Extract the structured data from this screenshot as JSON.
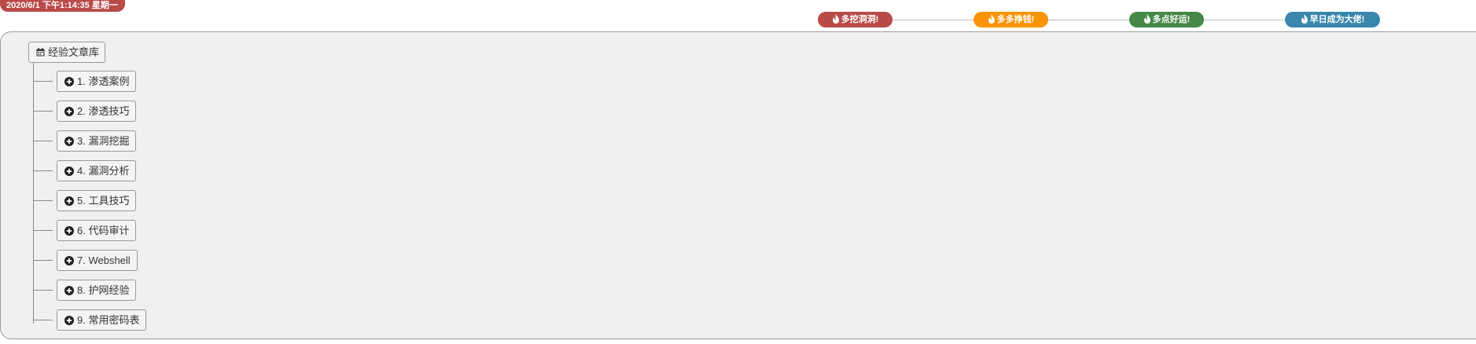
{
  "header": {
    "datetime": "2020/6/1 下午1:14:35 星期一",
    "datetime_color": "#b94a48"
  },
  "slogans": [
    {
      "label": "多挖洞洞!",
      "color": "#b94a48",
      "icon": "fire-icon"
    },
    {
      "label": "多多挣钱!",
      "color": "#f89406",
      "icon": "fire-icon"
    },
    {
      "label": "多点好运!",
      "color": "#468847",
      "icon": "fire-icon"
    },
    {
      "label": "早日成为大佬!",
      "color": "#3a87ad",
      "icon": "fire-icon"
    }
  ],
  "tree": {
    "root": {
      "label": "经验文章库",
      "icon": "calendar-icon"
    },
    "children": [
      {
        "label": "1. 渗透案例",
        "icon": "plus-circle-icon"
      },
      {
        "label": "2. 渗透技巧",
        "icon": "plus-circle-icon"
      },
      {
        "label": "3. 漏洞挖掘",
        "icon": "plus-circle-icon"
      },
      {
        "label": "4. 漏洞分析",
        "icon": "plus-circle-icon"
      },
      {
        "label": "5. 工具技巧",
        "icon": "plus-circle-icon"
      },
      {
        "label": "6. 代码审计",
        "icon": "plus-circle-icon"
      },
      {
        "label": "7. Webshell",
        "icon": "plus-circle-icon"
      },
      {
        "label": "8. 护网经验",
        "icon": "plus-circle-icon"
      },
      {
        "label": "9. 常用密码表",
        "icon": "plus-circle-icon"
      }
    ]
  }
}
